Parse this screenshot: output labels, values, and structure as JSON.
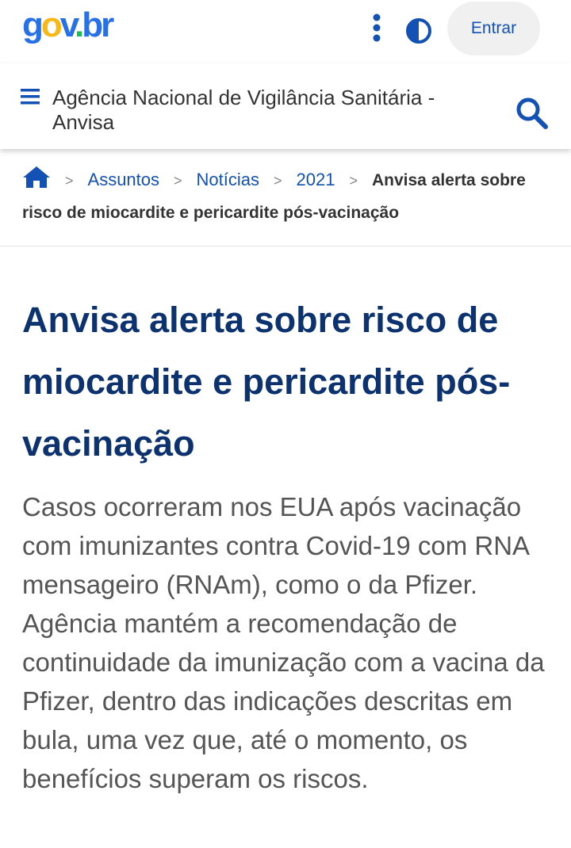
{
  "brand": {
    "logo_text": "gov.br",
    "colors": {
      "g": "#2670e8",
      "o": "#f8b816",
      "v": "#2670e8",
      "dot": "#1cbb59",
      "br": "#2670e8"
    }
  },
  "topbar": {
    "more_icon": "kebab-menu-icon",
    "contrast_icon": "contrast-icon",
    "login_label": "Entrar"
  },
  "header": {
    "menu_icon": "hamburger-menu-icon",
    "site_name": "Agência Nacional de Vigilância Sanitária - Anvisa",
    "search_icon": "search-icon"
  },
  "breadcrumb": {
    "home_icon": "home-icon",
    "separator": ">",
    "items": [
      {
        "label": "Assuntos"
      },
      {
        "label": "Notícias"
      },
      {
        "label": "2021"
      }
    ],
    "current": "Anvisa alerta sobre risco de miocardite e pericardite pós-vacinação"
  },
  "article": {
    "title": "Anvisa alerta sobre risco de miocardite e pericardite pós-vacinação",
    "lead": "Casos ocorreram nos EUA após vacinação com imunizantes contra Covid-19 com RNA mensageiro (RNAm), como o da Pfizer. Agência mantém a recomendação de continuidade da imunização com a vacina da Pfizer, dentro das indicações descritas em bula, uma vez que, até o momento, os benefícios superam os riscos."
  },
  "theme": {
    "primary_blue": "#1351b4",
    "title_blue": "#0c326f",
    "text_gray": "#555555",
    "button_bg": "#f0f0f0"
  }
}
